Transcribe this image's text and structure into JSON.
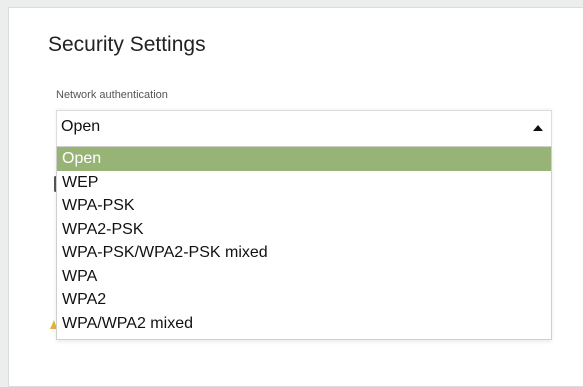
{
  "page": {
    "title": "Security Settings"
  },
  "network_auth": {
    "label": "Network authentication",
    "selected": "Open",
    "options": [
      "Open",
      "WEP",
      "WPA-PSK",
      "WPA2-PSK",
      "WPA-PSK/WPA2-PSK mixed",
      "WPA",
      "WPA2",
      "WPA/WPA2 mixed"
    ]
  },
  "colors": {
    "selected_option_bg": "#98b376",
    "warning_icon": "#e2b33a"
  },
  "icons": {
    "dropdown_caret": "caret-up-icon",
    "background_warning": "warning-icon"
  }
}
